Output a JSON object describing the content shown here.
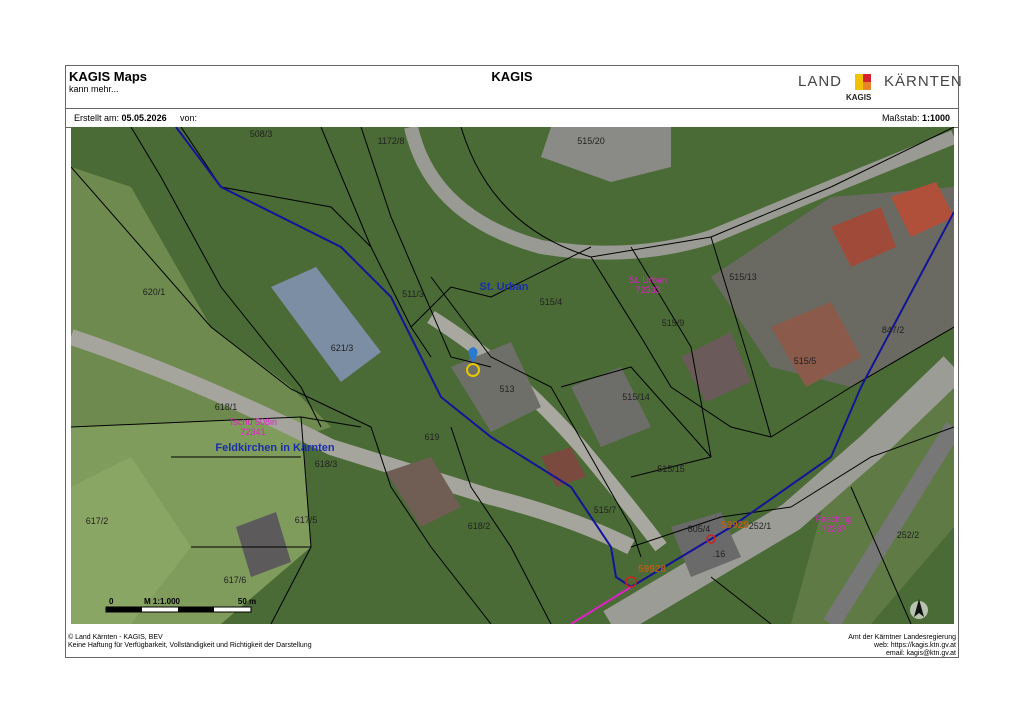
{
  "header": {
    "app_name": "KAGIS Maps",
    "app_tagline": "kann mehr...",
    "center_title": "KAGIS",
    "logo_left": "LAND",
    "logo_right": "KÄRNTEN",
    "logo_sub": "KAGIS"
  },
  "meta": {
    "created_label": "Erstellt am:",
    "created_date": "05.05.2026",
    "from_label": "von:",
    "scale_label": "Maßstab:",
    "scale_value": "1:1000"
  },
  "map": {
    "parcel_labels": [
      "508/3",
      "1172/8",
      "515/20",
      "620/1",
      "511/3",
      "515/4",
      "515/13",
      "621/3",
      "515/9",
      "513",
      "515/5",
      "618/1",
      "515/14",
      "847/2",
      "619",
      "618/3",
      "515/15",
      "617/2",
      "617/5",
      "515/7",
      "618/2",
      "805/4",
      "252/1",
      ".16",
      "252/2",
      "617/6"
    ],
    "place_labels": [
      "St. Urban",
      "Feldkirchen in Kärnten"
    ],
    "cadastral_labels": [
      {
        "name": "St. Urban",
        "code": "72333"
      },
      {
        "name": "Tschu 508in",
        "code": "72341"
      },
      {
        "name": "Fasching",
        "code": "72387"
      }
    ],
    "point_labels": [
      "59929",
      "59928"
    ],
    "scalebar": {
      "start": "0",
      "label": "M 1:1.000",
      "end": "50 m"
    },
    "colors": {
      "parcel_line": "#000000",
      "stream": "#14149a",
      "boundary": "#e020c8",
      "place_label": "#1a2fa8",
      "cadastral_label": "#e020c8",
      "point_label": "#b0601e"
    }
  },
  "footer": {
    "left_line1": "© Land Kärnten - KAGIS, BEV",
    "left_line2": "Keine Haftung für Verfügbarkeit, Vollständigkeit und Richtigkeit der Darstellung",
    "right_line1": "Amt der Kärntner Landesregierung",
    "right_line2": "web: https://kagis.ktn.gv.at",
    "right_line3": "email: kagis@ktn.gv.at"
  }
}
